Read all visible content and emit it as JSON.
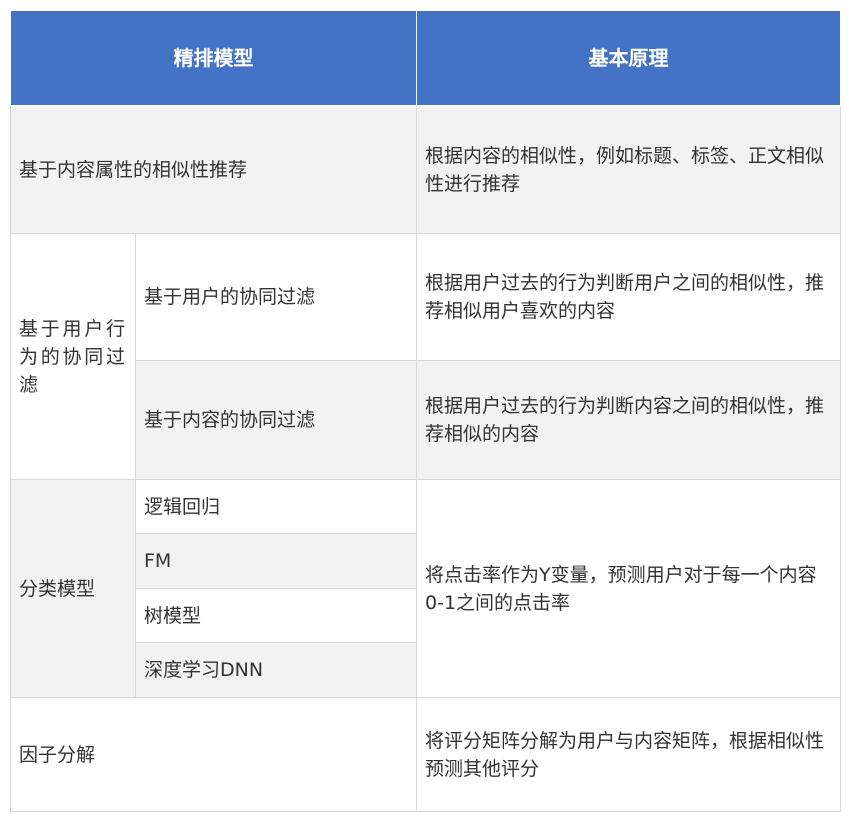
{
  "header": {
    "col1": "精排模型",
    "col2": "基本原理"
  },
  "rows": [
    {
      "model": "基于内容属性的相似性推荐",
      "principle": "根据内容的相似性，例如标题、标签、正文相似性进行推荐"
    },
    {
      "group": "基于用户行为的协同过滤",
      "subrows": [
        {
          "model": "基于用户的协同过滤",
          "principle": "根据用户过去的行为判断用户之间的相似性，推荐相似用户喜欢的内容"
        },
        {
          "model": "基于内容的协同过滤",
          "principle": "根据用户过去的行为判断内容之间的相似性，推荐相似的内容"
        }
      ]
    },
    {
      "group": "分类模型",
      "submodels": [
        "逻辑回归",
        "FM",
        "树模型",
        "深度学习DNN"
      ],
      "principle": "将点击率作为Y变量，预测用户对于每一个内容0-1之间的点击率"
    },
    {
      "model": "因子分解",
      "principle": "将评分矩阵分解为用户与内容矩阵，根据相似性预测其他评分"
    }
  ]
}
